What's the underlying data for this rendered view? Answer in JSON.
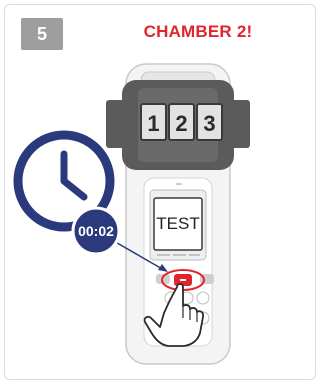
{
  "step": {
    "number": "5"
  },
  "header": {
    "title": "CHAMBER 2!"
  },
  "chamber_labels": [
    "1",
    "2",
    "3"
  ],
  "device": {
    "screen_text": "TEST"
  },
  "timer": {
    "value": "00:02"
  },
  "colors": {
    "accent_red": "#e0262c",
    "clock_navy": "#2b3a7c",
    "badge_gray": "#9e9e9e",
    "device_gray": "#5b5b5b"
  },
  "icons": [
    "clock-icon",
    "hand-pointer-icon"
  ]
}
